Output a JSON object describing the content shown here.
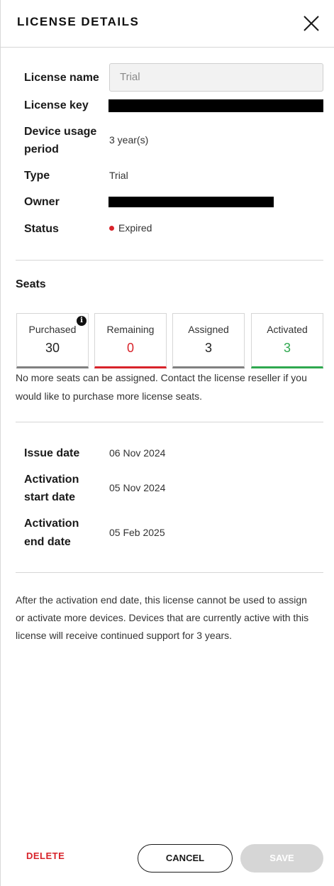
{
  "header": {
    "title": "LICENSE DETAILS"
  },
  "details": {
    "license_name_label": "License name",
    "license_name_value": "Trial",
    "license_key_label": "License key",
    "device_usage_label_line1": "Device usage",
    "device_usage_label_line2": "period",
    "device_usage_value": "3 year(s)",
    "type_label": "Type",
    "type_value": "Trial",
    "owner_label": "Owner",
    "status_label": "Status",
    "status_value": "Expired",
    "status_color": "#d8232a"
  },
  "seats": {
    "title": "Seats",
    "cards": [
      {
        "label": "Purchased",
        "value": "30",
        "color": "#222222",
        "bar_color": "#808080"
      },
      {
        "label": "Remaining",
        "value": "0",
        "color": "#d8232a",
        "bar_color": "#d8232a"
      },
      {
        "label": "Assigned",
        "value": "3",
        "color": "#222222",
        "bar_color": "#808080"
      },
      {
        "label": "Activated",
        "value": "3",
        "color": "#2fa84f",
        "bar_color": "#2fa84f"
      }
    ],
    "info_icon": "i",
    "message_line1": "No more seats can be assigned. Contact the license reseller if you",
    "message_line2": "would like to purchase more license seats."
  },
  "dates": {
    "issue_label": "Issue date",
    "issue_value": "06 Nov 2024",
    "activation_start_label_line1": "Activation",
    "activation_start_label_line2": "start date",
    "activation_start_value": "05 Nov 2024",
    "activation_end_label_line1": "Activation",
    "activation_end_label_line2": "end date",
    "activation_end_value": "05 Feb 2025"
  },
  "footer_note": {
    "line1": "After the activation end date, this license cannot be used to assign",
    "line2": "or activate more devices. Devices that are currently active with this",
    "line3": "license will receive continued support for 3 years."
  },
  "actions": {
    "delete_label": "DELETE",
    "cancel_label": "CANCEL",
    "save_label": "SAVE"
  }
}
